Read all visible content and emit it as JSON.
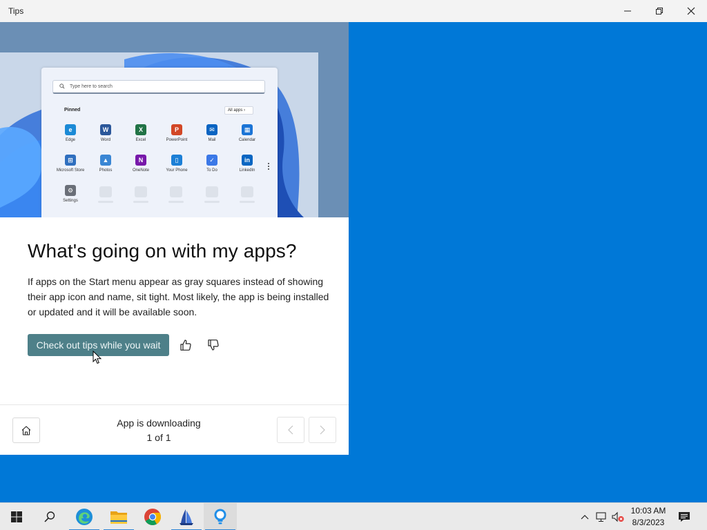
{
  "window": {
    "title": "Tips",
    "minimize_icon": "minimize-icon",
    "maximize_icon": "restore-icon",
    "close_icon": "close-icon"
  },
  "hero": {
    "search_placeholder": "Type here to search",
    "pinned_label": "Pinned",
    "all_apps_label": "All apps",
    "apps": [
      {
        "label": "Edge",
        "icon": "edge-icon",
        "color": "#1b8ad6"
      },
      {
        "label": "Word",
        "icon": "word-icon",
        "color": "#2b579a"
      },
      {
        "label": "Excel",
        "icon": "excel-icon",
        "color": "#217346"
      },
      {
        "label": "PowerPoint",
        "icon": "powerpoint-icon",
        "color": "#d24726"
      },
      {
        "label": "Mail",
        "icon": "mail-icon",
        "color": "#0a64c2"
      },
      {
        "label": "Calendar",
        "icon": "calendar-icon",
        "color": "#1b74d6"
      },
      {
        "label": "Microsoft Store",
        "icon": "store-icon",
        "color": "#2f6fbf"
      },
      {
        "label": "Photos",
        "icon": "photos-icon",
        "color": "#3a86d4"
      },
      {
        "label": "OneNote",
        "icon": "onenote-icon",
        "color": "#7719aa"
      },
      {
        "label": "Your Phone",
        "icon": "phone-icon",
        "color": "#1c7fd6"
      },
      {
        "label": "To Do",
        "icon": "todo-icon",
        "color": "#3b78e7"
      },
      {
        "label": "LinkedIn",
        "icon": "linkedin-icon",
        "color": "#0a66c2"
      },
      {
        "label": "Settings",
        "icon": "gear-icon",
        "color": "#6a6f78"
      }
    ]
  },
  "content": {
    "heading": "What's going on with my apps?",
    "description": "If apps on the Start menu appear as gray squares instead of showing their app icon and name, sit tight. Most likely, the app is being installed or updated and it will be available soon.",
    "cta_label": "Check out tips while you wait",
    "like_icon": "thumbs-up-icon",
    "dislike_icon": "thumbs-down-icon"
  },
  "footer": {
    "home_icon": "home-icon",
    "title": "App is downloading",
    "count": "1 of 1",
    "prev_icon": "chevron-left-icon",
    "next_icon": "chevron-right-icon"
  },
  "taskbar": {
    "items": [
      {
        "name": "start-button",
        "icon": "windows-icon"
      },
      {
        "name": "search-button",
        "icon": "search-icon"
      },
      {
        "name": "edge-taskbar-button",
        "icon": "edge-icon"
      },
      {
        "name": "file-explorer-button",
        "icon": "folder-icon"
      },
      {
        "name": "chrome-button",
        "icon": "chrome-icon"
      },
      {
        "name": "app-taskbar-button",
        "icon": "sail-icon"
      },
      {
        "name": "tips-taskbar-button",
        "icon": "lightbulb-icon"
      }
    ],
    "time": "10:03 AM",
    "date": "8/3/2023"
  },
  "colors": {
    "desktop": "#0078d7",
    "accent_button": "#4e8089",
    "taskbar": "#eaeaea"
  }
}
